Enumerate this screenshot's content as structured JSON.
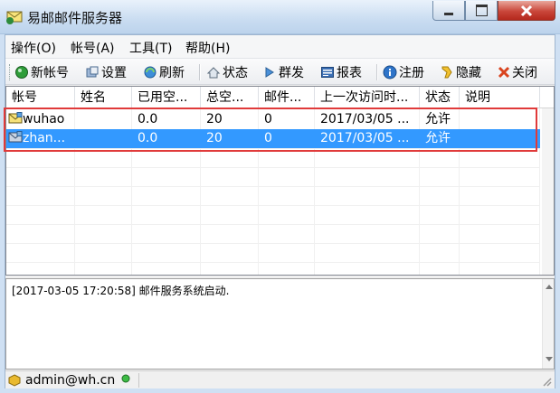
{
  "window": {
    "title": "易邮邮件服务器"
  },
  "menu": [
    "操作(O)",
    "帐号(A)",
    "工具(T)",
    "帮助(H)"
  ],
  "toolbar": {
    "new_account": "新帐号",
    "settings": "设置",
    "refresh": "刷新",
    "status": "状态",
    "broadcast": "群发",
    "report": "报表",
    "register": "注册",
    "hide": "隐藏",
    "close": "关闭"
  },
  "columns": [
    "帐号",
    "姓名",
    "已用空...",
    "总空...",
    "邮件...",
    "上一次访问时...",
    "状态",
    "说明"
  ],
  "rows": [
    {
      "account": "wuhao",
      "name": "",
      "used": "0.0",
      "total": "20",
      "mails": "0",
      "last_access": "2017/03/05 ...",
      "status": "允许",
      "desc": ""
    },
    {
      "account": "zhan...",
      "name": "",
      "used": "0.0",
      "total": "20",
      "mails": "0",
      "last_access": "2017/03/05 ...",
      "status": "允许",
      "desc": ""
    }
  ],
  "log": {
    "text": "[2017-03-05 17:20:58] 邮件服务系统启动."
  },
  "statusbar": {
    "user": "admin@wh.cn"
  },
  "colors": {
    "selection": "#3399ff",
    "highlight_box": "#e03a3a"
  }
}
